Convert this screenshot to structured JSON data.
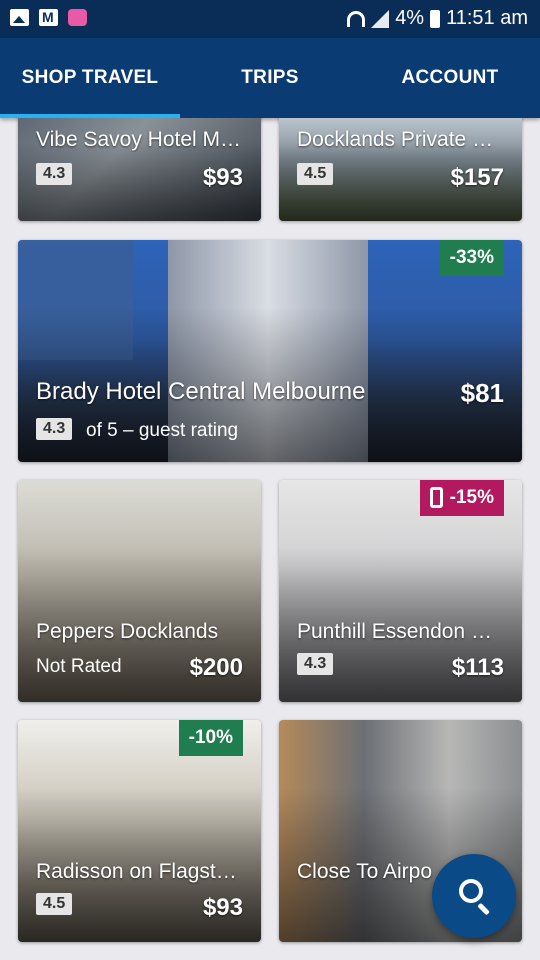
{
  "status": {
    "battery": "4%",
    "time": "11:51 am"
  },
  "tabs": [
    {
      "label": "SHOP TRAVEL",
      "active": true
    },
    {
      "label": "TRIPS",
      "active": false
    },
    {
      "label": "ACCOUNT",
      "active": false
    }
  ],
  "cards": [
    {
      "name": "Vibe Savoy Hotel M…",
      "rating": "4.3",
      "price": "$93"
    },
    {
      "name": "Docklands Private …",
      "rating": "4.5",
      "price": "$157"
    },
    {
      "name": "Brady Hotel Central Melbourne",
      "rating": "4.3",
      "rating_text": "of 5 – guest rating",
      "price": "$81",
      "discount": "-33%"
    },
    {
      "name": "Peppers Docklands",
      "rating": "Not Rated",
      "price": "$200"
    },
    {
      "name": "Punthill Essendon …",
      "rating": "4.3",
      "price": "$113",
      "discount": "-15%"
    },
    {
      "name": "Radisson on Flagst…",
      "rating": "4.5",
      "price": "$93",
      "discount": "-10%"
    },
    {
      "name": "Close To Airpo",
      "rating": "",
      "price": ""
    }
  ],
  "colors": {
    "nav_bg": "#0a3c73",
    "accent": "#2ab0f0",
    "discount_green": "#1f7d4f",
    "discount_pink": "#b3195f",
    "fab": "#0a4a86"
  },
  "icons": {
    "fab": "search-icon",
    "mobile_deal": "phone-icon"
  }
}
